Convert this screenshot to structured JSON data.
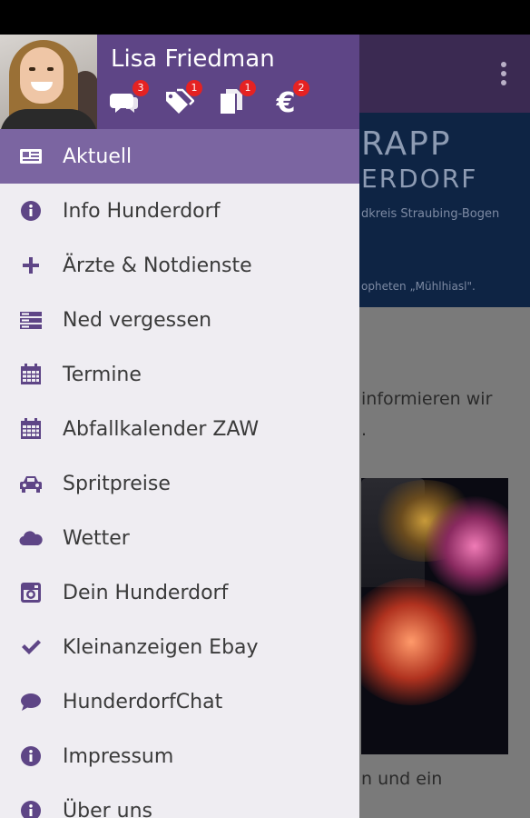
{
  "colors": {
    "accent": "#5e4586",
    "active_item": "#7b65a1",
    "drawer_bg": "#efedf2",
    "badge": "#e52222",
    "icon_color": "#5e4586"
  },
  "user": {
    "name": "Lisa Friedman"
  },
  "header_icons": [
    {
      "icon": "chat-bubbles-icon",
      "badge": "3"
    },
    {
      "icon": "tags-icon",
      "badge": "1"
    },
    {
      "icon": "documents-icon",
      "badge": "1"
    },
    {
      "icon": "euro-icon",
      "badge": "2"
    }
  ],
  "menu": {
    "items": [
      {
        "label": "Aktuell",
        "icon": "newspaper-icon",
        "active": true
      },
      {
        "label": "Info Hunderdorf",
        "icon": "info-icon"
      },
      {
        "label": "Ärzte & Notdienste",
        "icon": "plus-icon"
      },
      {
        "label": "Ned vergessen",
        "icon": "server-icon"
      },
      {
        "label": "Termine",
        "icon": "calendar-icon"
      },
      {
        "label": "Abfallkalender ZAW",
        "icon": "calendar-icon"
      },
      {
        "label": "Spritpreise",
        "icon": "car-icon"
      },
      {
        "label": "Wetter",
        "icon": "cloud-icon"
      },
      {
        "label": "Dein Hunderdorf",
        "icon": "camera-icon"
      },
      {
        "label": "Kleinanzeigen Ebay",
        "icon": "checkmark-icon"
      },
      {
        "label": "HunderdorfChat",
        "icon": "comment-icon"
      },
      {
        "label": "Impressum",
        "icon": "info-icon"
      },
      {
        "label": "Über uns",
        "icon": "info-icon"
      }
    ]
  },
  "background": {
    "banner_line1": "RAPP",
    "banner_line2": "ERDORF",
    "banner_line3": "dkreis Straubing-Bogen",
    "banner_line4": "opheten „Mühlhiasl\".",
    "text1": "informieren wir",
    "text2": ".",
    "text3": "n und ein"
  }
}
